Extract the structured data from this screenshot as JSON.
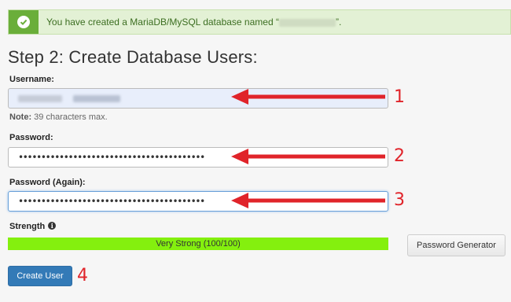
{
  "alert": {
    "message_prefix": "You have created a MariaDB/MySQL database named “",
    "message_suffix": "”.",
    "icon": "check-circle-icon",
    "color": "#6aae3a"
  },
  "page_title": "Step 2: Create Database Users:",
  "username": {
    "label": "Username:",
    "note_bold": "Note:",
    "note_text": " 39 characters max."
  },
  "password": {
    "label": "Password:",
    "value_masked": "•••••••••••••••••••••••••••••••••••••••••"
  },
  "password_again": {
    "label": "Password (Again):",
    "value_masked": "•••••••••••••••••••••••••••••••••••••••••"
  },
  "strength": {
    "label": "Strength",
    "info_icon": "info-circle-icon",
    "meter_text": "Very Strong (100/100)",
    "level": 1.0,
    "color": "#84f00e"
  },
  "buttons": {
    "password_generator": "Password Generator",
    "create_user": "Create User"
  },
  "callouts": [
    "1",
    "2",
    "3",
    "4"
  ],
  "annotation_color": "#e0242a"
}
